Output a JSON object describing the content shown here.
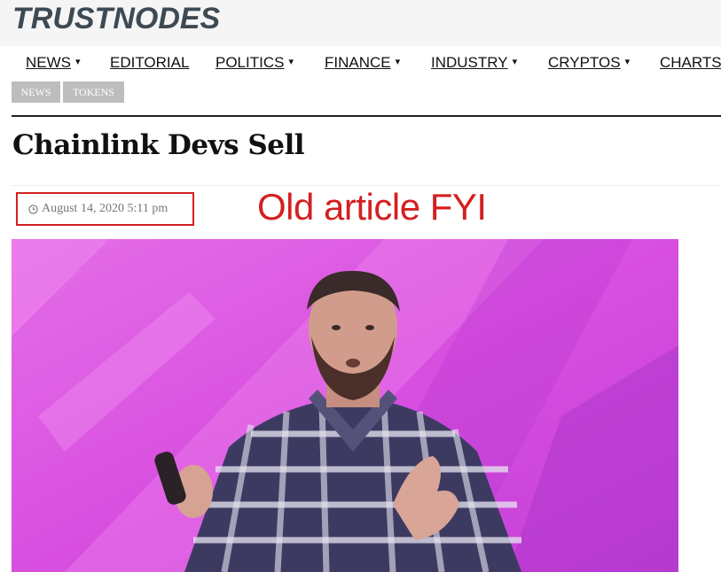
{
  "site": {
    "logo": "TRUSTNODES"
  },
  "nav": {
    "items": [
      {
        "label": "NEWS",
        "has_dropdown": true
      },
      {
        "label": "EDITORIAL",
        "has_dropdown": false
      },
      {
        "label": "POLITICS",
        "has_dropdown": true
      },
      {
        "label": "FINANCE",
        "has_dropdown": true
      },
      {
        "label": "INDUSTRY",
        "has_dropdown": true
      },
      {
        "label": "CRYPTOS",
        "has_dropdown": true
      },
      {
        "label": "CHARTS",
        "has_dropdown": false
      }
    ],
    "caret": "▾"
  },
  "tags": [
    "NEWS",
    "TOKENS"
  ],
  "article": {
    "title": "Chainlink Devs Sell",
    "date": "August 14, 2020 5:11 pm"
  },
  "annotation": {
    "text": "Old article FYI",
    "color": "#d42020"
  },
  "hero_image": {
    "subject": "speaker-on-stage",
    "background_color": "#e060e6"
  },
  "colors": {
    "logo": "#3e4a53",
    "tag_bg": "#bdbdbd",
    "highlight": "#d42020"
  }
}
